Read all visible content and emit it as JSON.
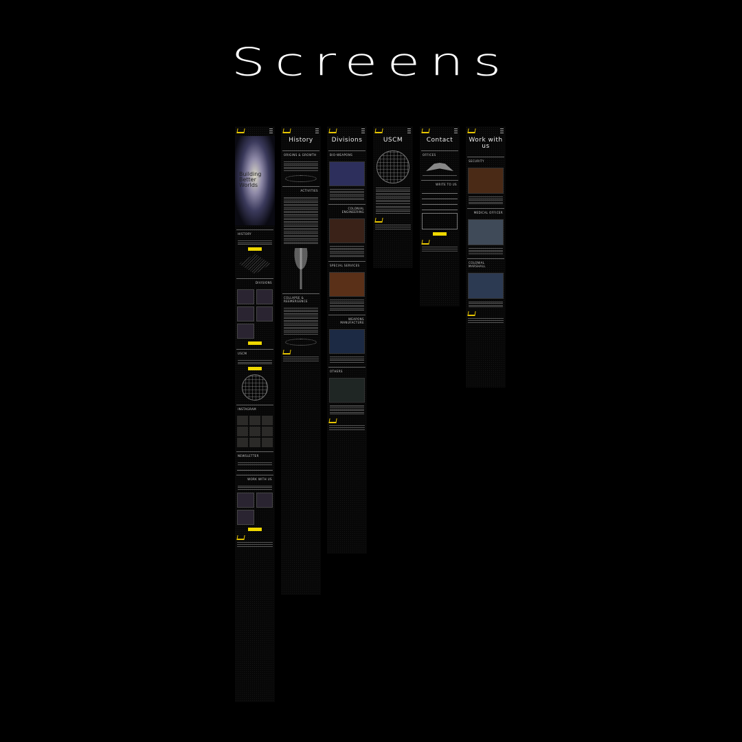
{
  "heading": "Screens",
  "accent_color": "#f0d800",
  "screens": [
    {
      "hero": "Building Better Worlds",
      "sections": [
        "HISTORY",
        "DIVISIONS",
        "USCM",
        "INSTAGRAM",
        "NEWSLETTER",
        "WORK WITH US"
      ]
    },
    {
      "title": "History",
      "sections": [
        "ORIGINS & GROWTH",
        "ACTIVITIES",
        "COLLAPSE & REEMERGENCE"
      ]
    },
    {
      "title": "Divisions",
      "sections": [
        "BIO-WEAPONS",
        "COLONIAL ENGINEERING",
        "SPECIAL SERVICES",
        "WEAPONS MANUFACTURE",
        "OTHERS"
      ]
    },
    {
      "title": "USCM",
      "sections": []
    },
    {
      "title": "Contact",
      "sections": [
        "OFFICES",
        "WRITE TO US"
      ]
    },
    {
      "title": "Work with us",
      "sections": [
        "SECURITY",
        "MEDICAL OFFICER",
        "COLONIAL MARSHALL"
      ]
    }
  ]
}
